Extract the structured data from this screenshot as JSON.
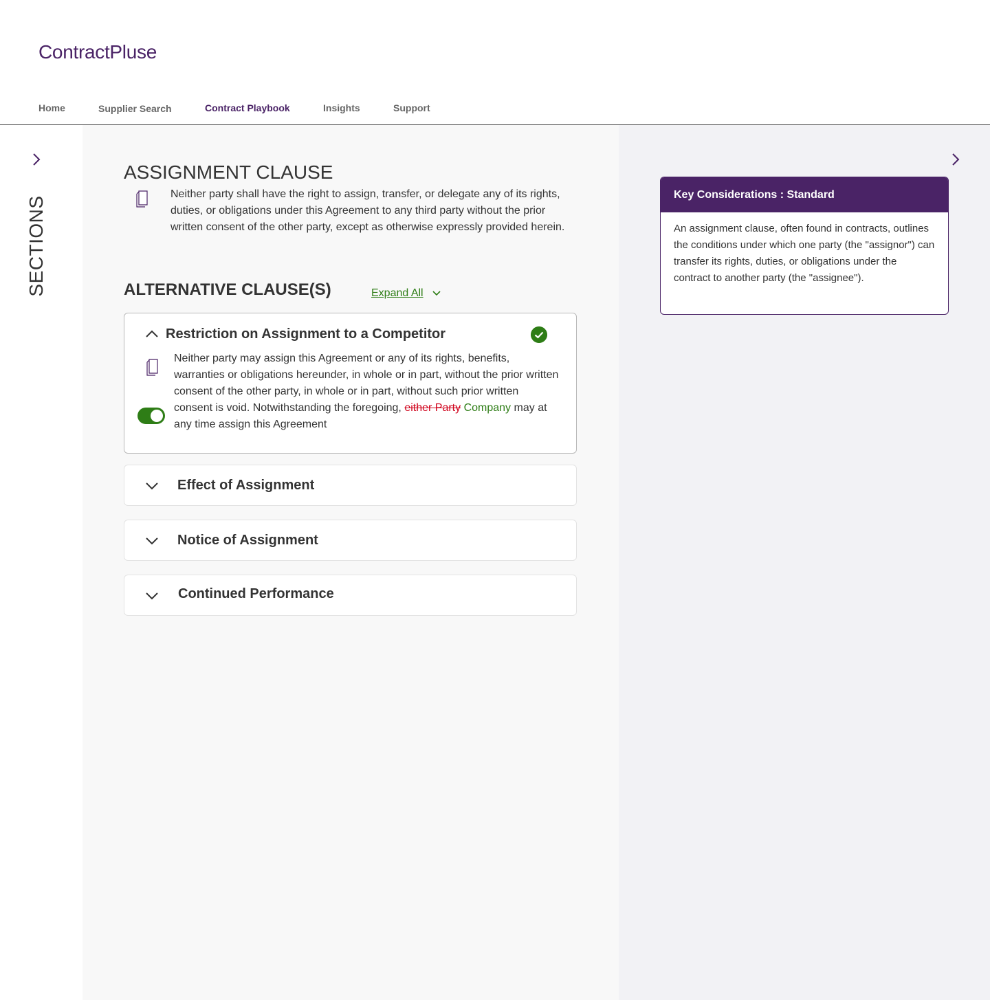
{
  "app": {
    "logo": "ContractPluse"
  },
  "nav": {
    "items": [
      {
        "label": "Home",
        "active": false
      },
      {
        "label": "Supplier Search",
        "active": false
      },
      {
        "label": "Contract Playbook",
        "active": true
      },
      {
        "label": "Insights",
        "active": false
      },
      {
        "label": "Support",
        "active": false
      }
    ]
  },
  "sidebar": {
    "label": "SECTIONS",
    "icon": "chevron-right-icon"
  },
  "clause": {
    "title": "ASSIGNMENT CLAUSE",
    "text": "Neither party shall have the right to assign, transfer, or delegate any of its rights, duties, or obligations under this Agreement to any third party without the prior written consent of the other party, except as otherwise expressly provided herein.",
    "copy_icon": "copy-icon"
  },
  "alternatives": {
    "title": "ALTERNATIVE CLAUSE(S)",
    "expand_all": "Expand All",
    "items": [
      {
        "title": "Restriction on Assignment to a Competitor",
        "expanded": true,
        "selected": true,
        "toggle_on": true,
        "text_before": "Neither party may assign this Agreement or any of its rights, benefits, warranties or obligations hereunder, in whole or in part, without the prior written consent of the other party, in whole or in part, without such prior written consent is void. Notwithstanding the foregoing, ",
        "deleted": "either Party",
        "inserted": "Company",
        "text_after": "may at any time assign this Agreement"
      },
      {
        "title": "Effect of Assignment",
        "expanded": false
      },
      {
        "title": "Notice of Assignment",
        "expanded": false
      },
      {
        "title": "Continued Performance",
        "expanded": false
      }
    ]
  },
  "key_considerations": {
    "header": "Key Considerations : Standard",
    "body": "An assignment clause, often found in contracts, outlines the conditions under which one party (the \"assignor\") can transfer its rights, duties, or obligations under the contract to another party (the \"assignee\")."
  },
  "colors": {
    "brand": "#4a2366",
    "success": "#2e7d16",
    "deletion": "#d0021b"
  }
}
